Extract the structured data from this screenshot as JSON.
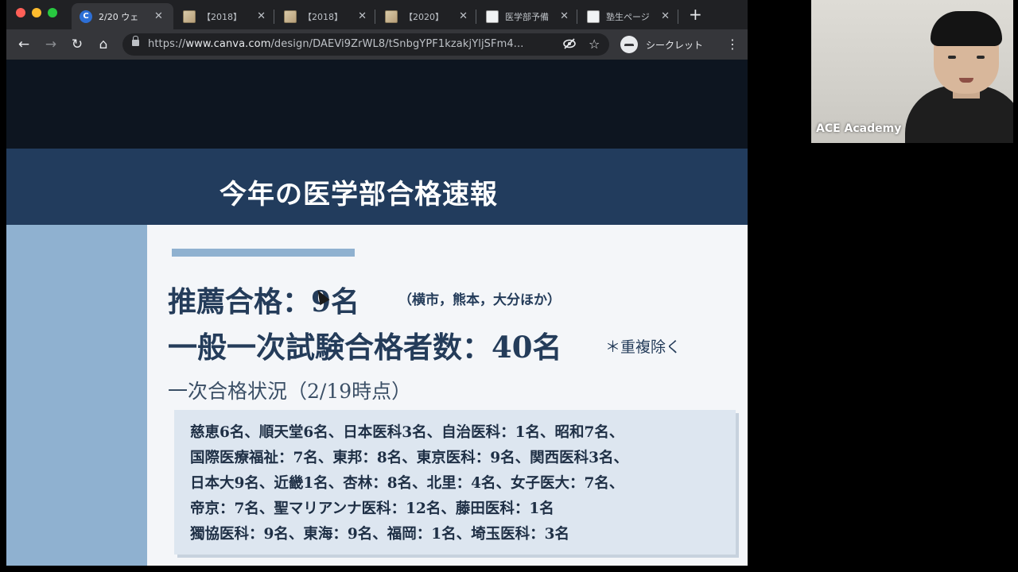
{
  "browser": {
    "tabs": [
      {
        "label": "2/20 ウェ",
        "favicon": "canva-icon",
        "favicon_text": "C",
        "active": true
      },
      {
        "label": "【2018】",
        "favicon": "image-icon",
        "active": false
      },
      {
        "label": "【2018】",
        "favicon": "image-icon",
        "active": false
      },
      {
        "label": "【2020】",
        "favicon": "image-icon",
        "active": false
      },
      {
        "label": "医学部予備",
        "favicon": "document-icon",
        "active": false
      },
      {
        "label": "塾生ページ",
        "favicon": "document-icon",
        "active": false
      }
    ],
    "tab_close_glyph": "✕",
    "new_tab_glyph": "+",
    "nav": {
      "back": "←",
      "forward": "→",
      "reload": "↻",
      "home": "⌂"
    },
    "address": {
      "scheme": "https://",
      "host": "www.canva.com",
      "path": "/design/DAEVi9ZrWL8/tSnbgYPF1kzakjYljSFm4..."
    },
    "incognito_label": "シークレット",
    "menu_glyph": "⋮"
  },
  "slide": {
    "title": "今年の医学部合格速報",
    "recommendation_line": "推薦合格：9名",
    "recommendation_note": "（横市，熊本，大分ほか）",
    "first_exam_line": "一般一次試験合格者数：40名",
    "first_exam_note": "＊重複除く",
    "status_heading": "一次合格状況（2/19時点）",
    "results": [
      "慈恵6名、順天堂6名、日本医科3名、自治医科：1名、昭和7名、",
      "国際医療福祉：7名、東邦：8名、東京医科：9名、関西医科3名、",
      "日本大9名、近畿1名、杏林：8名、北里：4名、女子医大：7名、",
      "帝京：7名、聖マリアンナ医科：12名、藤田医科：1名",
      "獨協医科：9名、東海：9名、福岡：1名、埼玉医科：3名"
    ]
  },
  "webcam": {
    "participant_name": "ACE Academy"
  },
  "colors": {
    "banner": "#223c5d",
    "side_panel": "#8fb1d0",
    "text_dark": "#243c5a"
  }
}
